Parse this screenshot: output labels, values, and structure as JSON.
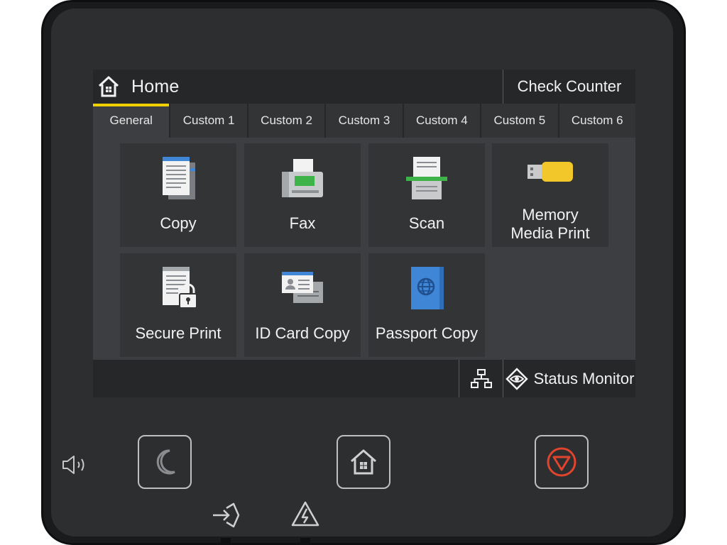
{
  "header": {
    "title": "Home",
    "check_counter": "Check Counter"
  },
  "tabs": [
    {
      "label": "General",
      "active": true
    },
    {
      "label": "Custom 1"
    },
    {
      "label": "Custom 2"
    },
    {
      "label": "Custom 3"
    },
    {
      "label": "Custom 4"
    },
    {
      "label": "Custom 5"
    },
    {
      "label": "Custom 6"
    }
  ],
  "tiles": {
    "copy": "Copy",
    "fax": "Fax",
    "scan": "Scan",
    "memory_line1": "Memory",
    "memory_line2": "Media Print",
    "secure_print": "Secure Print",
    "id_card_copy": "ID Card Copy",
    "passport_copy": "Passport Copy"
  },
  "footer": {
    "status_monitor": "Status Monitor"
  },
  "icons": {
    "home": "home-icon",
    "network": "network-icon",
    "status": "eye-diamond-icon",
    "sleep": "moon-icon",
    "stop": "stop-icon",
    "volume": "speaker-icon",
    "data": "data-in-icon",
    "error": "warning-icon"
  },
  "colors": {
    "accent": "#f0d000",
    "stop": "#e0442d",
    "fax_green": "#3db34a",
    "doc_blue": "#3f86d6",
    "usb_yellow": "#f2c72a"
  }
}
